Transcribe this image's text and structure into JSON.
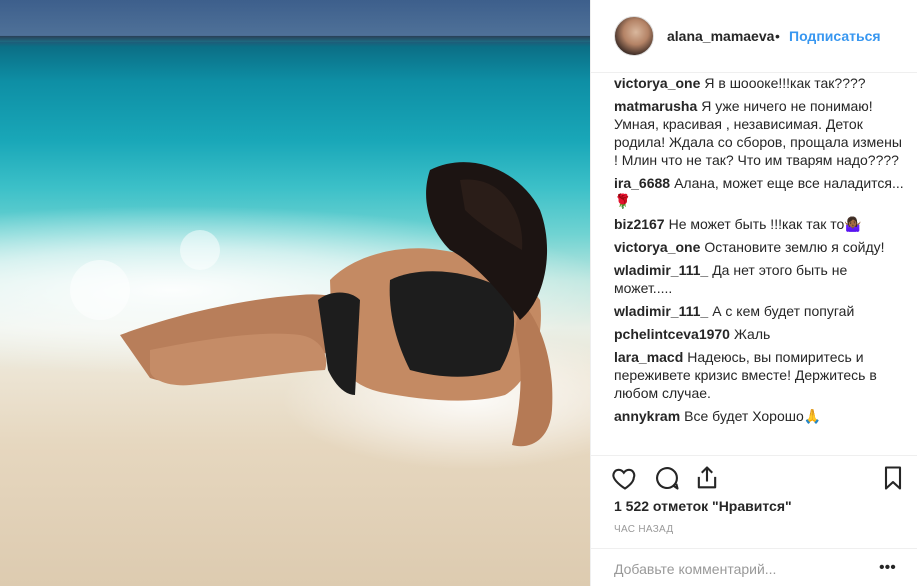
{
  "post": {
    "username": "alana_mamaeva",
    "separator": "•",
    "follow_label": "Подписаться"
  },
  "comments": [
    {
      "user": "victorya_one",
      "text": "Я в шоооке!!!как так????"
    },
    {
      "user": "matmarusha",
      "text": "Я уже ничего не понимаю! Умная, красивая , независимая. Деток родила! Ждала со сборов, прощала измены ! Млин что не так? Что им тварям надо????"
    },
    {
      "user": "ira_6688",
      "text": "Алана, может еще все наладится...🌹"
    },
    {
      "user": "biz2167",
      "text": "Не может быть !!!как так то🤷🏾‍♀️"
    },
    {
      "user": "victorya_one",
      "text": "Остановите землю я сойду!"
    },
    {
      "user": "wladimir_111_",
      "text": "Да нет этого быть не может....."
    },
    {
      "user": "wladimir_111_",
      "text": "А с кем будет попугай"
    },
    {
      "user": "pchelintceva1970",
      "text": "Жаль"
    },
    {
      "user": "lara_macd",
      "text": "Надеюсь, вы помиритесь и переживете кризис вместе! Держитесь в любом случае."
    },
    {
      "user": "annykram",
      "text": "Все будет Хорошо🙏"
    }
  ],
  "stats": {
    "likes_text": "1 522 отметок \"Нравится\"",
    "time_text": "ЧАС НАЗАД"
  },
  "add_comment": {
    "placeholder": "Добавьте комментарий...",
    "more_label": "•••"
  },
  "icons": {
    "like": "heart-icon",
    "comment": "comment-bubble-icon",
    "share": "share-icon",
    "save": "bookmark-icon"
  }
}
